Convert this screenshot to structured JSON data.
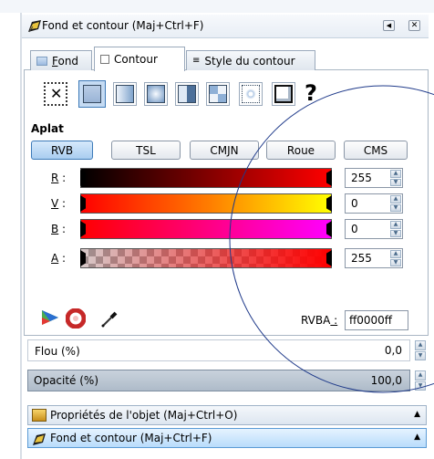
{
  "panel": {
    "title": "Fond et contour (Maj+Ctrl+F)"
  },
  "tabs": [
    {
      "label": "Fond",
      "accesskey_prefix": "",
      "accesskey": "F",
      "rest": "ond",
      "active": false
    },
    {
      "label": "Contour",
      "active": true
    },
    {
      "label": "Style du contour",
      "active": false
    }
  ],
  "paint_types": [
    "none-icon",
    "flat-color-icon",
    "linear-gradient-icon",
    "radial-gradient-icon",
    "mesh-gradient-icon",
    "pattern-icon",
    "swatch-icon",
    "unset-icon"
  ],
  "paint_type_unset_glyph": "?",
  "section": {
    "label": "Aplat"
  },
  "modes": [
    {
      "label": "RVB",
      "active": true
    },
    {
      "label": "TSL",
      "active": false
    },
    {
      "label": "CMJN",
      "active": false
    },
    {
      "label": "Roue",
      "active": false
    },
    {
      "label": "CMS",
      "active": false
    }
  ],
  "sliders": [
    {
      "key": "R",
      "label_rest": " :",
      "value": "255"
    },
    {
      "key": "V",
      "label_rest": " :",
      "value": "0"
    },
    {
      "key": "B",
      "label_rest": " :",
      "value": "0"
    },
    {
      "key": "A",
      "label_rest": " :",
      "value": "255"
    }
  ],
  "rgba": {
    "label_prefix": "RVBA",
    "label_suffix": " :",
    "value": "ff0000ff"
  },
  "blur": {
    "label": "Flou (%)",
    "value": "0,0"
  },
  "opacity": {
    "label": "Opacité (%)",
    "value": "100,0",
    "level": 1.0
  },
  "docked": [
    {
      "label": "Propriétés de l'objet (Maj+Ctrl+O)"
    },
    {
      "label": "Fond et contour (Maj+Ctrl+F)"
    }
  ],
  "colors": {
    "accent_blue": "#3d7ab8",
    "current_color": "#ff0000",
    "annotation_circle": "#1f3a8a"
  }
}
